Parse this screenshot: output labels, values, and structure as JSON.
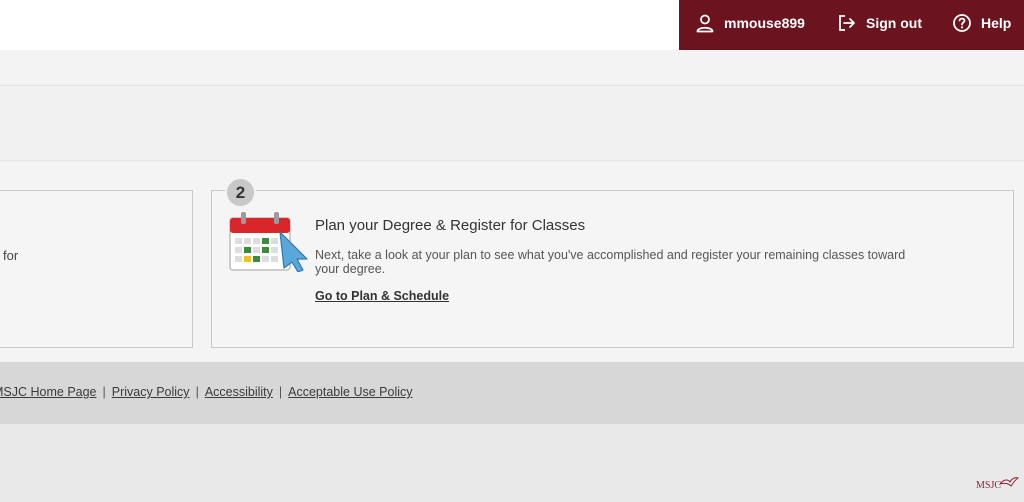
{
  "header": {
    "user": {
      "label": "mmouse899",
      "icon": "user-icon"
    },
    "signout": {
      "label": "Sign out",
      "icon": "sign-out-icon"
    },
    "help": {
      "label": "Help",
      "icon": "help-icon"
    },
    "accent_color": "#6b1420"
  },
  "steps": {
    "left_partial_text": "for",
    "step2": {
      "number": "2",
      "title": "Plan your Degree & Register for Classes",
      "description": "Next, take a look at your plan to see what you've accomplished and register your remaining classes toward your degree.",
      "link": "Go to Plan & Schedule",
      "icon": "calendar-icon"
    }
  },
  "footer": {
    "links": [
      "MSJC Home Page",
      "Privacy Policy",
      "Accessibility",
      "Acceptable Use Policy"
    ],
    "separator": "|"
  },
  "watermark": {
    "text": "MSJC"
  }
}
